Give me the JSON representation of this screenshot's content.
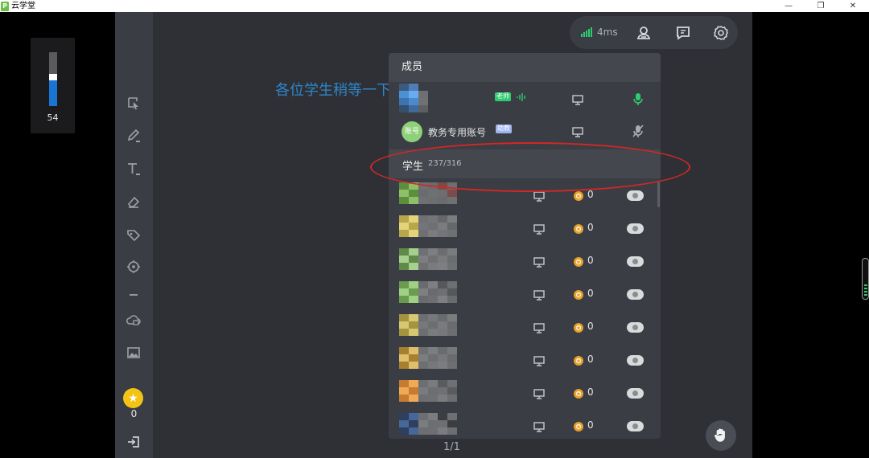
{
  "window": {
    "title": "云学堂",
    "app_icon_glyph": "P",
    "minimize_glyph": "—",
    "restore_glyph": "❐",
    "close_glyph": "✕"
  },
  "volume": {
    "value": "54",
    "level": 0.54
  },
  "whiteboard": {
    "text": "各位学生稍等一下",
    "page": "1/1"
  },
  "toolbar": {
    "tools": [
      "select-tool-icon",
      "pen-tool-icon",
      "text-tool-icon",
      "eraser-tool-icon",
      "label-tool-icon",
      "laser-pointer-icon",
      "line-tool-icon",
      "cloud-upload-icon",
      "image-icon"
    ],
    "coin_count": "0",
    "coin_glyph": "★"
  },
  "controls": {
    "latency": "4ms",
    "icons": [
      "members-icon",
      "chat-icon",
      "settings-icon"
    ]
  },
  "member_panel": {
    "title": "成员",
    "teacher": {
      "tag": "老师"
    },
    "assistant": {
      "name": "教务专用账号",
      "tag": "助教",
      "avatar_text": "账号"
    },
    "students_label": "学生",
    "students_count": "237/316",
    "students": [
      {
        "badge": "0",
        "colors": [
          "#5b8f3c",
          "#8fc069",
          "#6f7072",
          "#6a6b6e",
          "#7b4a4b",
          "#6d6e70"
        ]
      },
      {
        "badge": "0",
        "colors": [
          "#b9a64a",
          "#e3d37a",
          "#6f7072",
          "#74757a",
          "#66676a",
          "#7b7c7f"
        ]
      },
      {
        "badge": "0",
        "colors": [
          "#5f8a4a",
          "#a7d08e",
          "#6f7072",
          "#7d7e81",
          "#6c6d70",
          "#7a7b7e"
        ]
      },
      {
        "badge": "0",
        "colors": [
          "#6a9b4f",
          "#9fd184",
          "#6a6b6e",
          "#7e7f82",
          "#56575a",
          "#6e6f72"
        ]
      },
      {
        "badge": "0",
        "colors": [
          "#a49440",
          "#d6c774",
          "#6d6e70",
          "#77787b",
          "#6a6b6e",
          "#7a7b7d"
        ]
      },
      {
        "badge": "0",
        "colors": [
          "#a67f2f",
          "#dfbf6b",
          "#6e6f71",
          "#7c7d80",
          "#6a6b6e",
          "#77787a"
        ]
      },
      {
        "badge": "0",
        "colors": [
          "#c77b30",
          "#f0a955",
          "#6d6e70",
          "#7a7b7e",
          "#5a5b5e",
          "#6f7073"
        ]
      },
      {
        "badge": "0",
        "colors": [
          "#2f3f5e",
          "#45679a",
          "#6d6e70",
          "#7b7c7f",
          "#3c3d40",
          "#6e6f72"
        ]
      }
    ]
  },
  "colors": {
    "accent_green": "#2ecc71",
    "panel_bg": "#3a3d43",
    "highlight_red": "#d12828",
    "whiteboard_text": "#2f86c9"
  }
}
